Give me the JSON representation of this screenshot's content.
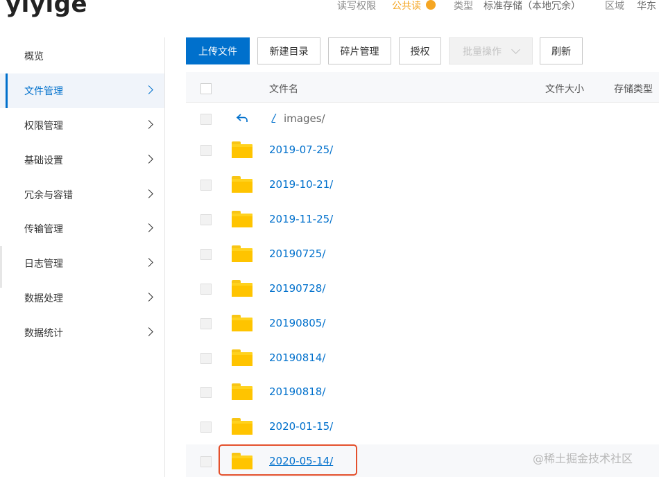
{
  "header": {
    "bucket_name": "yiyige",
    "permission_label": "读写权限",
    "permission_value": "公共读",
    "type_label": "类型",
    "type_value": "标准存储（本地冗余）",
    "region_label": "区域",
    "region_value": "华东"
  },
  "sidebar": {
    "items": [
      {
        "label": "概览",
        "has_chevron": false,
        "active": false
      },
      {
        "label": "文件管理",
        "has_chevron": true,
        "active": true
      },
      {
        "label": "权限管理",
        "has_chevron": true,
        "active": false
      },
      {
        "label": "基础设置",
        "has_chevron": true,
        "active": false
      },
      {
        "label": "冗余与容错",
        "has_chevron": true,
        "active": false
      },
      {
        "label": "传输管理",
        "has_chevron": true,
        "active": false
      },
      {
        "label": "日志管理",
        "has_chevron": true,
        "active": false
      },
      {
        "label": "数据处理",
        "has_chevron": true,
        "active": false
      },
      {
        "label": "数据统计",
        "has_chevron": true,
        "active": false
      }
    ]
  },
  "toolbar": {
    "upload_label": "上传文件",
    "new_dir_label": "新建目录",
    "fragment_label": "碎片管理",
    "authorize_label": "授权",
    "batch_label": "批量操作",
    "refresh_label": "刷新"
  },
  "table": {
    "columns": {
      "name": "文件名",
      "size": "文件大小",
      "storage": "存储类型"
    },
    "back_row": {
      "slash": "/",
      "path": "images/"
    },
    "rows": [
      {
        "name": "2019-07-25/"
      },
      {
        "name": "2019-10-21/"
      },
      {
        "name": "2019-11-25/"
      },
      {
        "name": "20190725/"
      },
      {
        "name": "20190728/"
      },
      {
        "name": "20190805/"
      },
      {
        "name": "20190814/"
      },
      {
        "name": "20190818/"
      },
      {
        "name": "2020-01-15/"
      },
      {
        "name": "2020-05-14/"
      }
    ]
  },
  "watermark": "@稀土掘金技术社区",
  "colors": {
    "accent": "#0070cc",
    "folder": "#ffc400",
    "highlight_border": "#e4502c"
  }
}
